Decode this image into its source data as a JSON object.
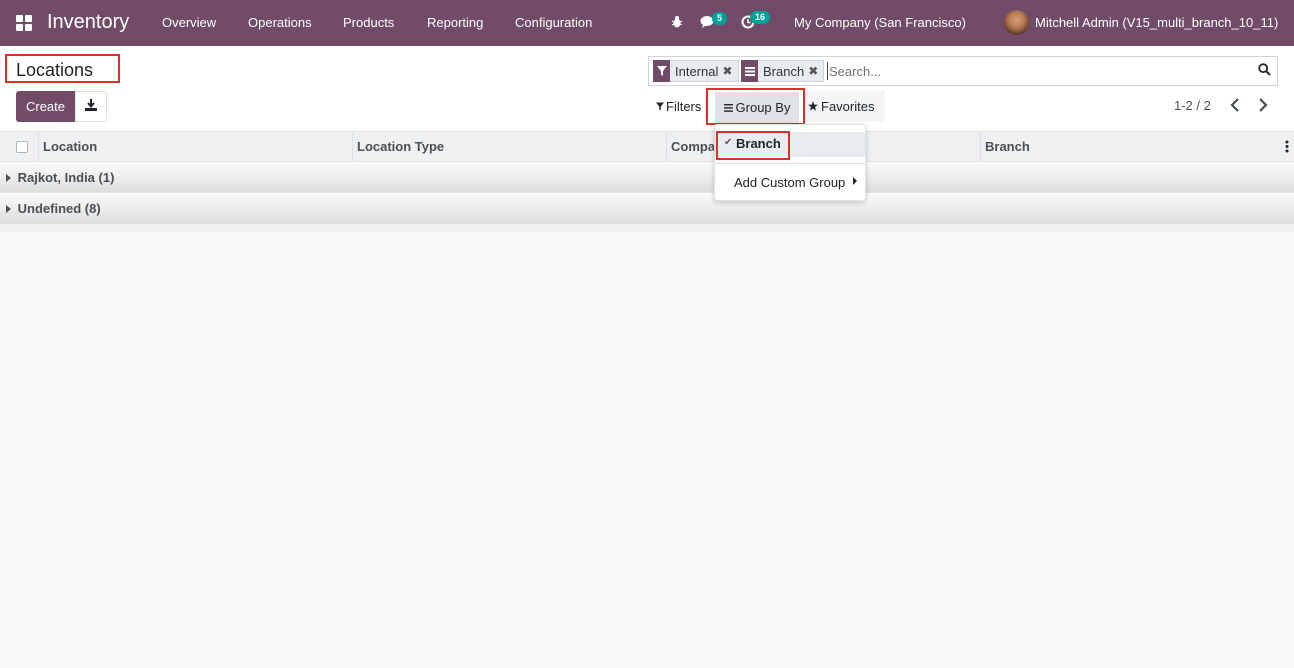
{
  "app": {
    "title": "Inventory",
    "menu": [
      "Overview",
      "Operations",
      "Products",
      "Reporting",
      "Configuration"
    ]
  },
  "systray": {
    "bug_icon": "bug-icon",
    "messages_icon": "comments-icon",
    "messages_count": "5",
    "activity_icon": "clock-icon",
    "activity_count": "16",
    "company": "My Company (San Francisco)",
    "user": "Mitchell Admin (V15_multi_branch_10_11)"
  },
  "control_panel": {
    "breadcrumb": "Locations",
    "create_label": "Create",
    "download_icon": "download-icon",
    "facets": [
      {
        "icon": "filter-icon",
        "label": "Internal"
      },
      {
        "icon": "list-icon",
        "label": "Branch"
      }
    ],
    "search_placeholder": "Search...",
    "filters_label": "Filters",
    "groupby_label": "Group By",
    "favorites_label": "Favorites",
    "pager": "1-2 / 2"
  },
  "groupby_dropdown": {
    "selected_item": "Branch",
    "custom_group_label": "Add Custom Group"
  },
  "list": {
    "columns": [
      "Location",
      "Location Type",
      "Company",
      "Branch"
    ],
    "groups": [
      "Rajkot, India (1)",
      "Undefined (8)"
    ]
  },
  "colors": {
    "brand": "#714b67",
    "badge": "#00a09d",
    "highlight": "#d9302a"
  }
}
